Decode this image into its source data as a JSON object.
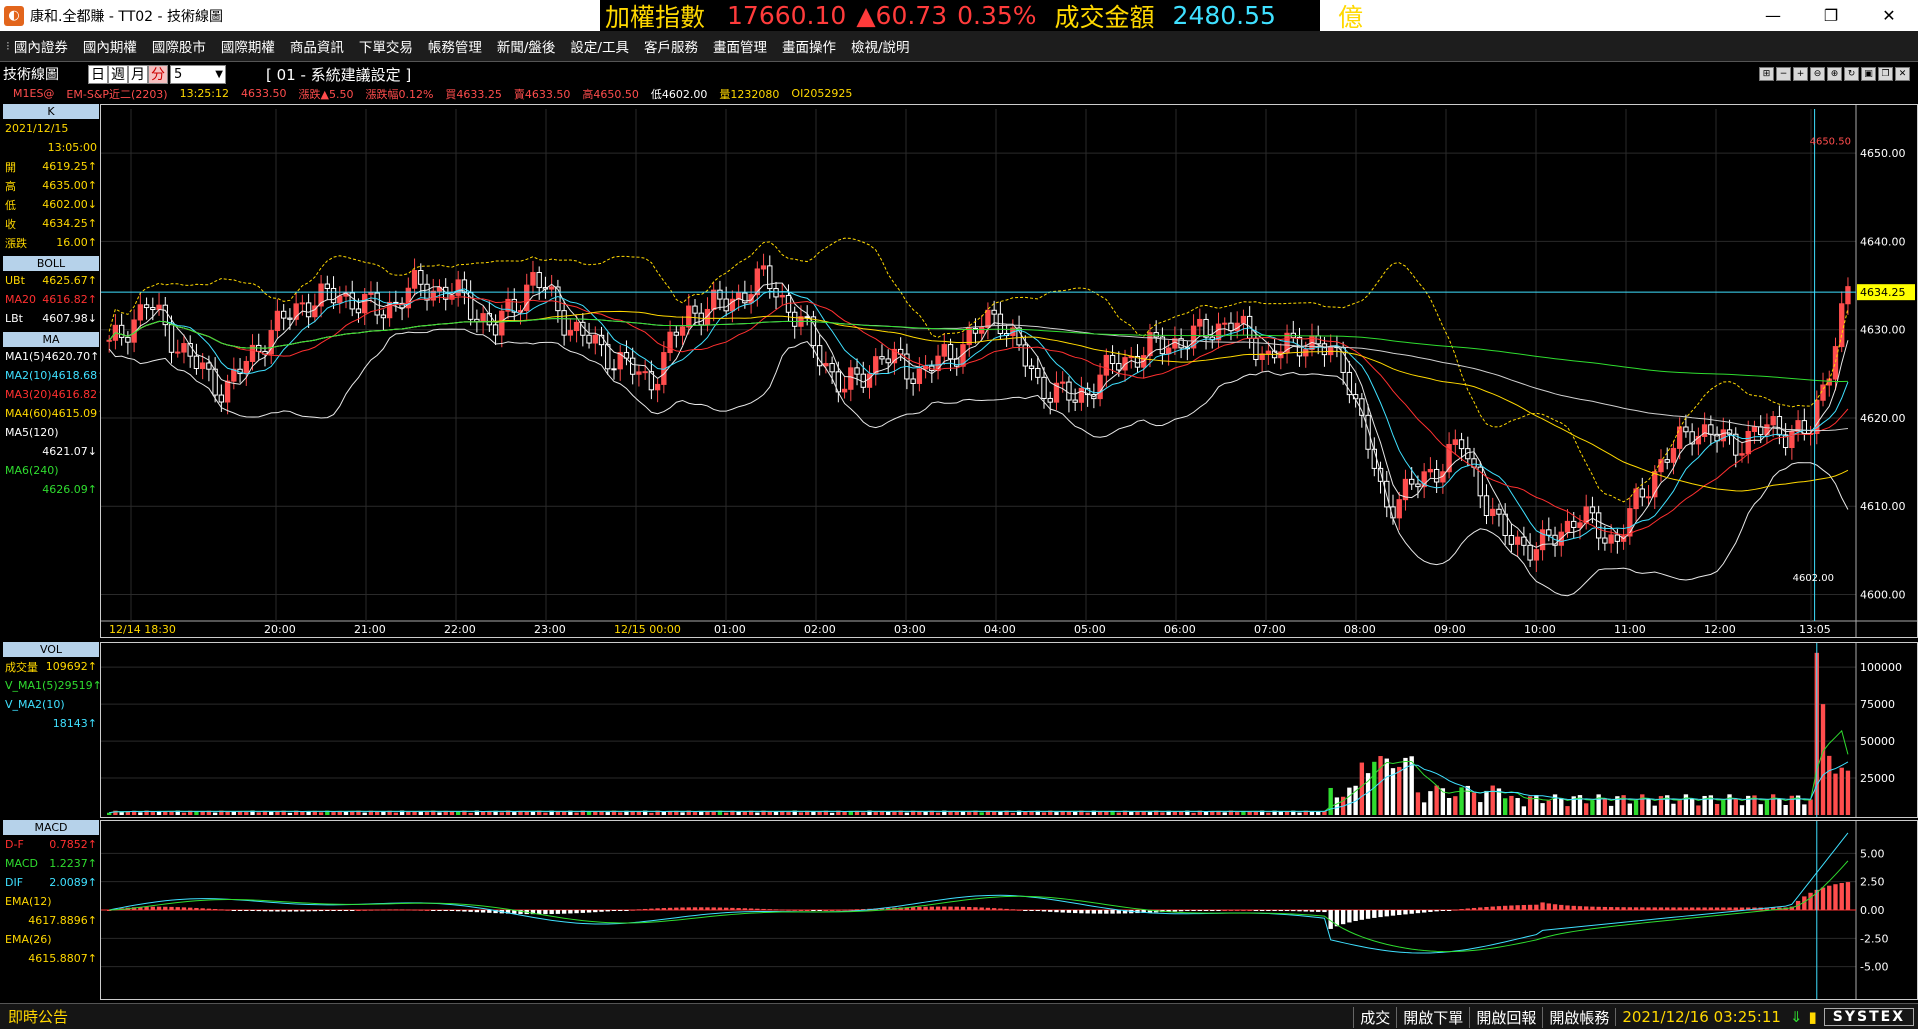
{
  "window": {
    "title": "康和.全都賺 - TT02 - 技術線圖",
    "logo": "logo-icon"
  },
  "ticker": {
    "name": "加權指數",
    "value": "17660.10",
    "change": "▲60.73",
    "percent": "0.35%",
    "volume_label": "成交金額",
    "volume": "2480.55",
    "unit": "億"
  },
  "menu": [
    "國內證券",
    "國內期權",
    "國際股市",
    "國際期權",
    "商品資訊",
    "下單交易",
    "帳務管理",
    "新聞/盤後",
    "設定/工具",
    "客戶服務",
    "畫面管理",
    "畫面操作",
    "檢視/說明"
  ],
  "toolbar": {
    "panel_title": "技術線圖",
    "periods": [
      "日",
      "週",
      "月",
      "分"
    ],
    "active_period": "分",
    "interval": "5",
    "settings": "[ 01 - 系統建議設定 ]"
  },
  "quote": {
    "symbol": "M1ES@",
    "name": "EM-S&P近二(2203)",
    "time": "13:25:12",
    "price": "4633.50",
    "change": "漲跌▲5.50",
    "change_pct": "漲跌幅0.12%",
    "buy": "買4633.25",
    "sell": "賣4633.50",
    "high": "高4650.50",
    "low": "低4602.00",
    "volume": "量1232080",
    "oi": "OI2052925"
  },
  "k_panel": {
    "header": "K",
    "date": "2021/12/15",
    "time": "13:05:00",
    "rows": [
      {
        "label": "開",
        "value": "4619.25↑"
      },
      {
        "label": "高",
        "value": "4635.00↑"
      },
      {
        "label": "低",
        "value": "4602.00↓"
      },
      {
        "label": "收",
        "value": "4634.25↑"
      },
      {
        "label": "漲跌",
        "value": "16.00↑"
      }
    ]
  },
  "boll_panel": {
    "header": "BOLL",
    "rows": [
      {
        "label": "UBt",
        "value": "4625.67↑"
      },
      {
        "label": "MA20",
        "value": "4616.82↑"
      },
      {
        "label": "LBt",
        "value": "4607.98↓"
      }
    ]
  },
  "ma_panel": {
    "header": "MA",
    "rows": [
      {
        "label": "MA1(5)",
        "value": "4620.70↑"
      },
      {
        "label": "MA2(10)",
        "value": "4618.68↑"
      },
      {
        "label": "MA3(20)",
        "value": "4616.82↑"
      },
      {
        "label": "MA4(60)",
        "value": "4615.09↑"
      },
      {
        "label": "MA5(120)",
        "value": ""
      },
      {
        "label": "",
        "value": "4621.07↓"
      },
      {
        "label": "MA6(240)",
        "value": ""
      },
      {
        "label": "",
        "value": "4626.09↑"
      }
    ]
  },
  "vol_panel": {
    "header": "VOL",
    "rows": [
      {
        "label": "成交量",
        "value": "109692↑"
      },
      {
        "label": "V_MA1(5)",
        "value": "29519↑"
      },
      {
        "label": "V_MA2(10)",
        "value": ""
      },
      {
        "label": "",
        "value": "18143↑"
      }
    ]
  },
  "macd_panel": {
    "header": "MACD",
    "rows": [
      {
        "label": "D-F",
        "value": "0.7852↑"
      },
      {
        "label": "MACD",
        "value": "1.2237↑"
      },
      {
        "label": "DIF",
        "value": "2.0089↑"
      },
      {
        "label": "EMA(12)",
        "value": ""
      },
      {
        "label": "",
        "value": "4617.8896↑"
      },
      {
        "label": "EMA(26)",
        "value": ""
      },
      {
        "label": "",
        "value": "4615.8807↑"
      }
    ]
  },
  "colors": {
    "up": "#ff4d4d",
    "down": "#ffffff",
    "label_yellow": "#ffd800",
    "cyan": "#3fe0ff",
    "green": "#2fdc2f",
    "red_line": "#ff3030",
    "white_line": "#e8e8e8",
    "header_bg": "#b6d2ea"
  },
  "chart_data": {
    "type": "candlestick",
    "price_axis": {
      "ticks": [
        4650.0,
        4640.0,
        4630.0,
        4620.0,
        4610.0,
        4600.0
      ],
      "min": 4597,
      "max": 4655
    },
    "time_axis": [
      "12/14 18:30",
      "20:00",
      "21:00",
      "22:00",
      "23:00",
      "12/15 00:00",
      "01:00",
      "02:00",
      "03:00",
      "04:00",
      "05:00",
      "06:00",
      "07:00",
      "08:00",
      "09:00",
      "10:00",
      "11:00",
      "12:00",
      "13:05"
    ],
    "current_price_label": "4634.25",
    "high_label": "4650.50",
    "low_label": "4602.00",
    "crosshair_price": 4634.25,
    "volume_axis": {
      "ticks": [
        "100000",
        "75000",
        "50000",
        "25000"
      ]
    },
    "macd_axis": {
      "ticks": [
        "5.00",
        "2.50",
        "0.00",
        "-2.50",
        "-5.00"
      ]
    },
    "key_closes": [
      4628,
      4633,
      4627,
      4623,
      4629,
      4633,
      4634,
      4632,
      4635,
      4634,
      4630,
      4636,
      4630,
      4627,
      4624,
      4632,
      4633,
      4636,
      4630,
      4623,
      4627,
      4625,
      4628,
      4632,
      4624,
      4622,
      4626,
      4628,
      4629,
      4631,
      4627,
      4629,
      4626,
      4610,
      4613,
      4617,
      4607,
      4605,
      4609,
      4606,
      4614,
      4619,
      4617,
      4619,
      4618,
      4634
    ]
  }
}
